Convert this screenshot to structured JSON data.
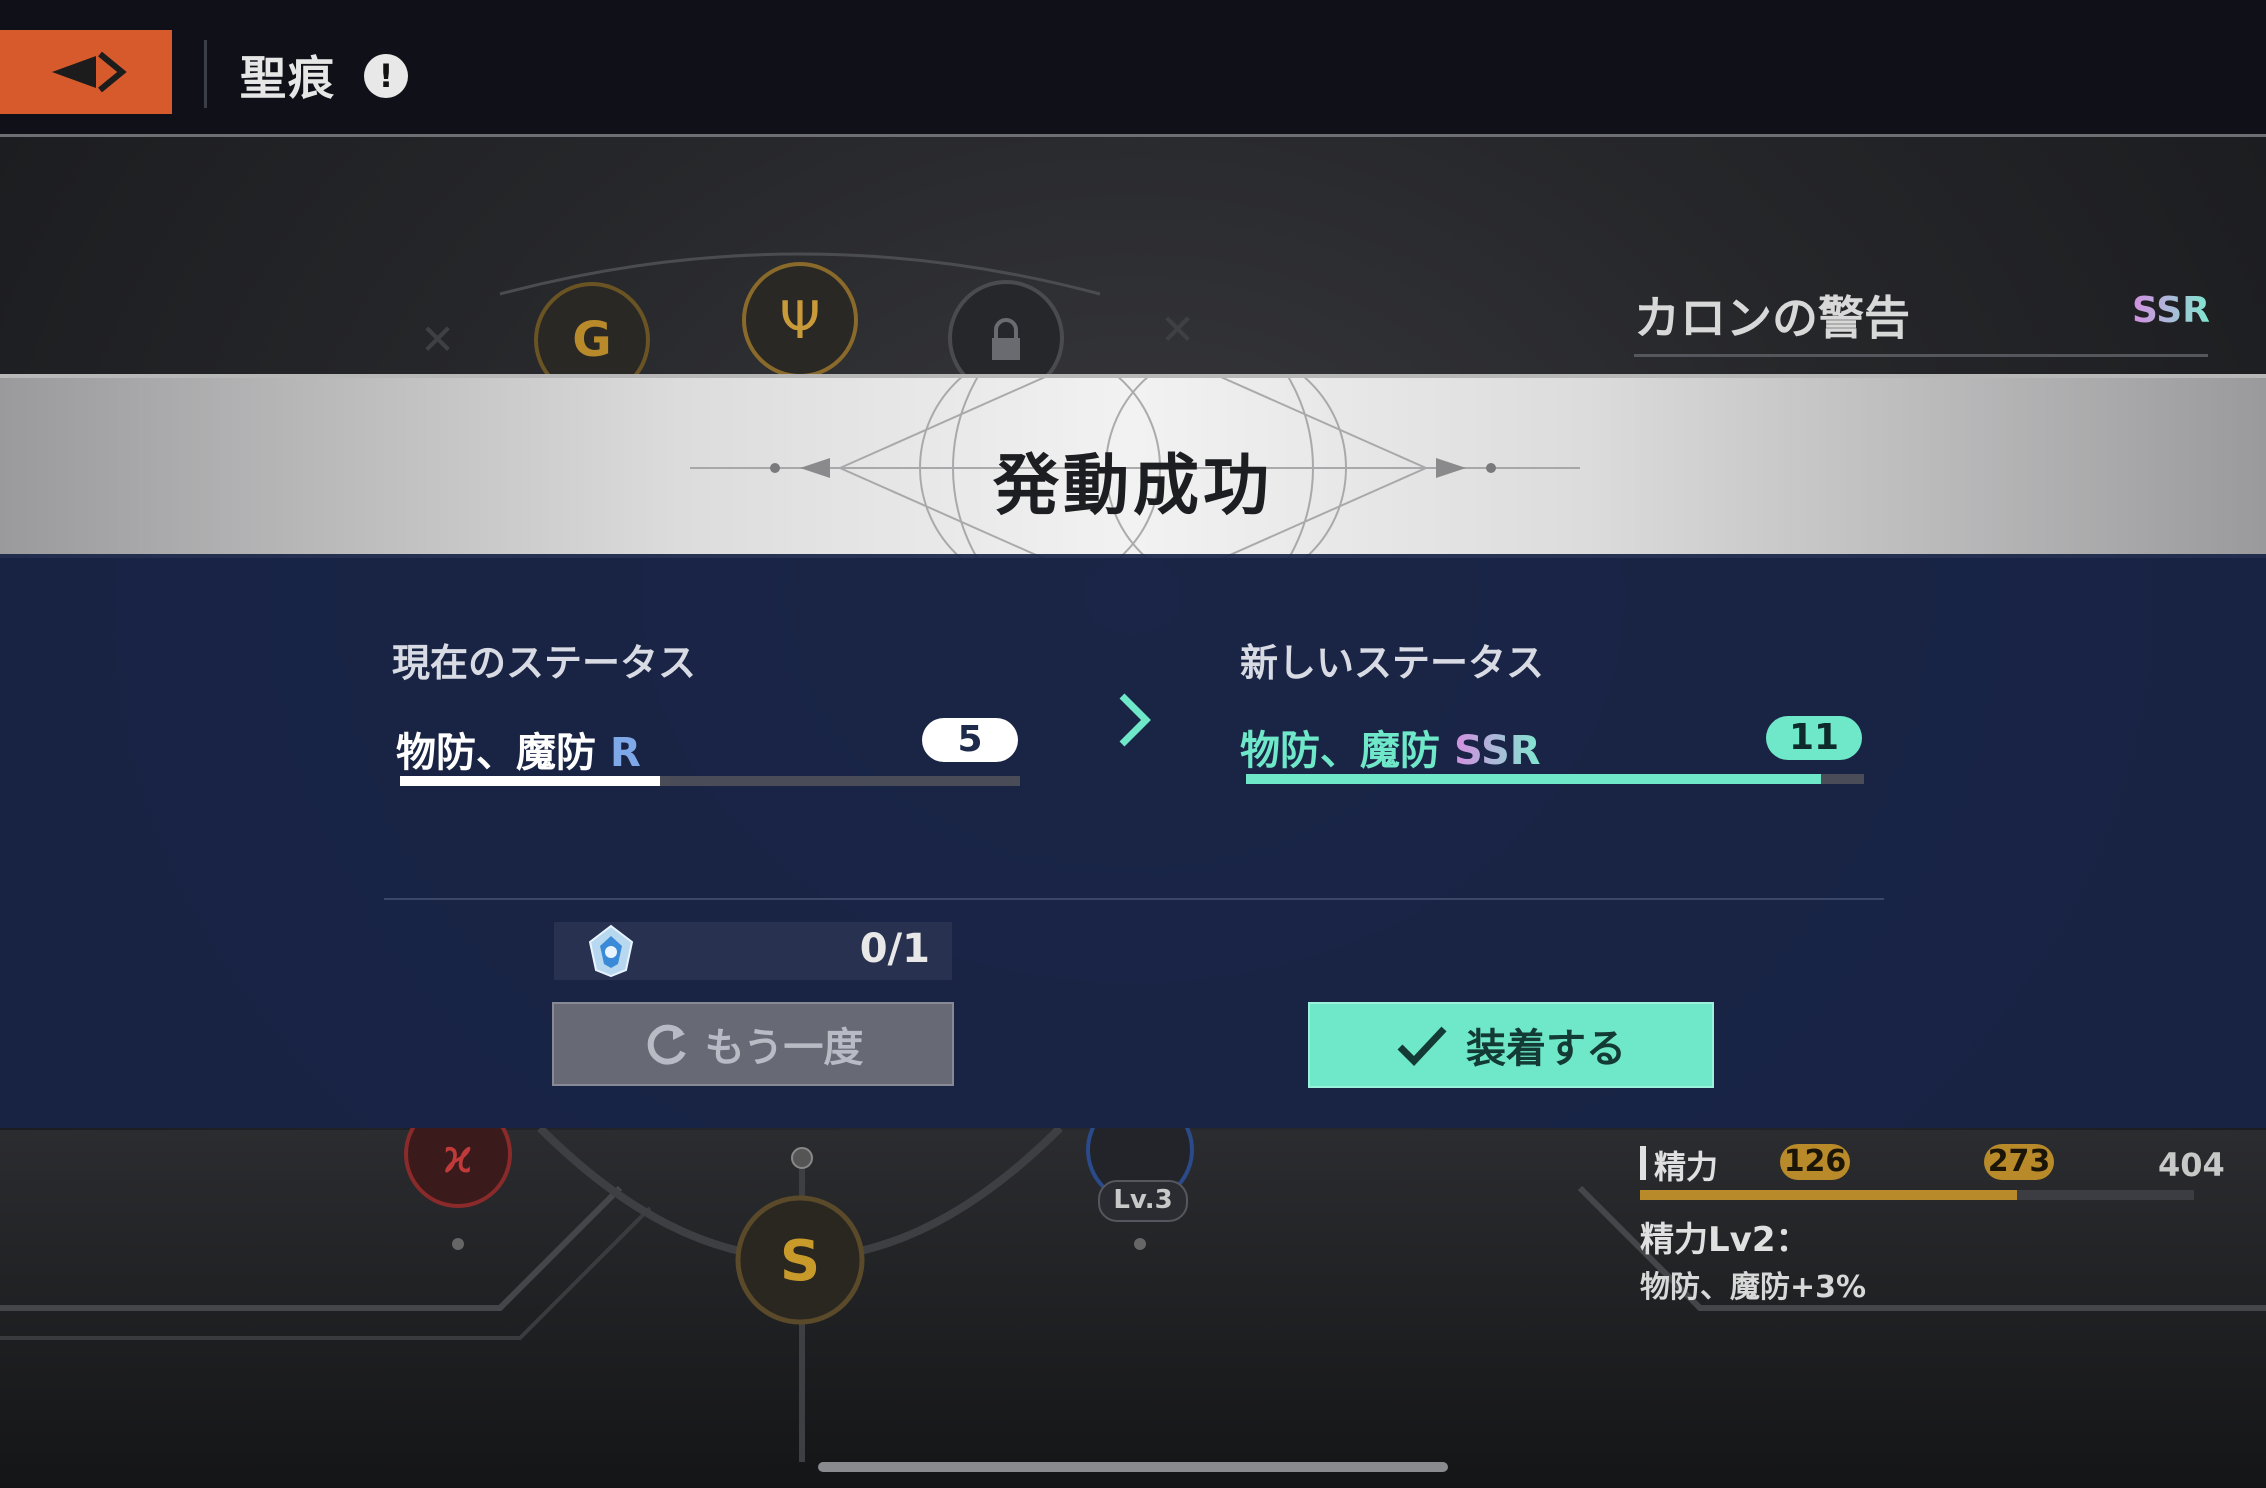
{
  "header": {
    "title": "聖痕",
    "back_icon": "back-arrow-icon",
    "info_icon": "!"
  },
  "item": {
    "name": "カロンの警告",
    "rarity": "SSR"
  },
  "banner": {
    "title": "発動成功"
  },
  "current_status": {
    "heading": "現在のステータス",
    "stat_name": "物防、魔防",
    "rarity": "R",
    "value": "5",
    "progress": 0.42
  },
  "new_status": {
    "heading": "新しいステータス",
    "stat_name": "物防、魔防",
    "rarity": "SSR",
    "value": "11",
    "progress": 0.93
  },
  "material": {
    "count": "0/1"
  },
  "buttons": {
    "retry_label": "もう一度",
    "equip_label": "装着する"
  },
  "stamina": {
    "label": "精力",
    "value1": "126",
    "value2": "273",
    "max": "404",
    "progress": 0.68,
    "level_text": "精力Lv2：",
    "effect_text": "物防、魔防+3%"
  },
  "skill_node": {
    "level_label": "Lv.3"
  },
  "colors": {
    "accent_orange": "#d65a2c",
    "accent_teal": "#6ee8c8",
    "panel_navy": "#182448",
    "stamina_gold": "#b88a2a"
  }
}
